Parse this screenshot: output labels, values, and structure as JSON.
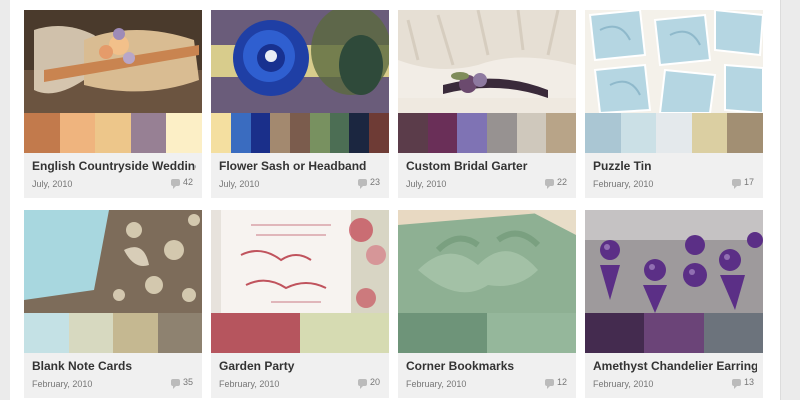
{
  "palettes": [
    {
      "title": "English Countryside Wedding G",
      "date": "July, 2010",
      "comments": "42",
      "photo_icon": "lace-flower-garter",
      "swatches": [
        "#c27a4c",
        "#efb47e",
        "#edc68a",
        "#978094",
        "#fcefc6"
      ]
    },
    {
      "title": "Flower Sash or Headband",
      "date": "July, 2010",
      "comments": "23",
      "photo_icon": "blue-flower-peacock",
      "swatches": [
        "#f4dfa0",
        "#3a6cc0",
        "#1a2f8a",
        "#a3896f",
        "#7b5c4d",
        "#789160",
        "#4c6e54",
        "#1b2640",
        "#6e3b35"
      ]
    },
    {
      "title": "Custom Bridal Garter",
      "date": "July, 2010",
      "comments": "22",
      "photo_icon": "bridal-garter",
      "swatches": [
        "#5b3c4a",
        "#6a2f58",
        "#7f73b4",
        "#979291",
        "#cfc8bc",
        "#b8a488"
      ]
    },
    {
      "title": "Puzzle Tin",
      "date": "February, 2010",
      "comments": "17",
      "photo_icon": "blue-tiles",
      "swatches": [
        "#aac6d3",
        "#cbe0e6",
        "#e4e9ec",
        "#dbcfa2",
        "#a28f73"
      ]
    },
    {
      "title": "Blank Note Cards",
      "date": "February, 2010",
      "comments": "35",
      "photo_icon": "paisley-cards",
      "swatches": [
        "#c4e1e5",
        "#d7d9c0",
        "#c5b891",
        "#8e8270"
      ]
    },
    {
      "title": "Garden Party",
      "date": "February, 2010",
      "comments": "20",
      "photo_icon": "invitation-card",
      "swatches": [
        "#b6555e",
        "#d6dbb2"
      ]
    },
    {
      "title": "Corner Bookmarks",
      "date": "February, 2010",
      "comments": "12",
      "photo_icon": "green-bookmark",
      "swatches": [
        "#6e9479",
        "#95b79b"
      ]
    },
    {
      "title": "Amethyst Chandelier Earrings",
      "date": "February, 2010",
      "comments": "13",
      "photo_icon": "amethyst-earrings",
      "swatches": [
        "#442b4f",
        "#6b4478",
        "#6c737c"
      ]
    }
  ]
}
